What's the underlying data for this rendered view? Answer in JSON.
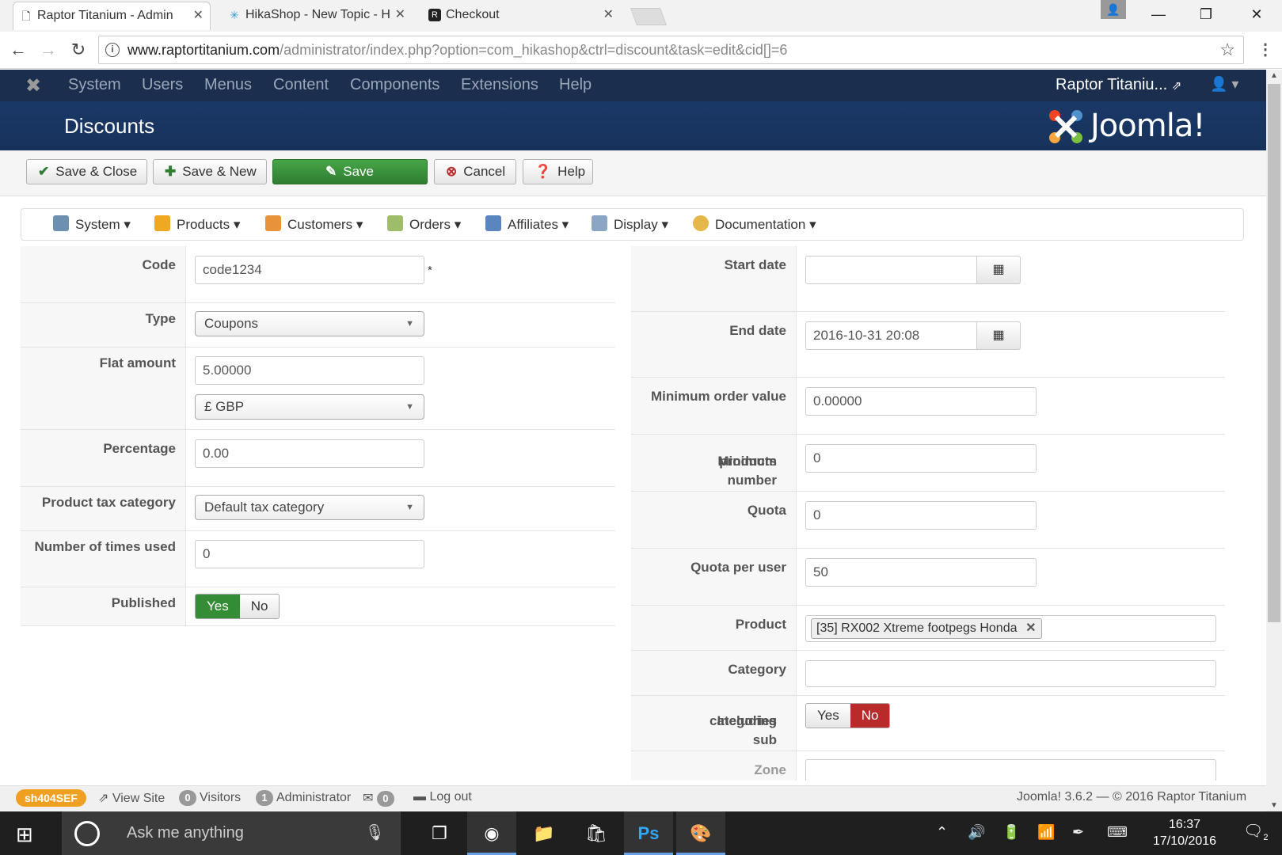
{
  "browser": {
    "tabs": [
      {
        "title": "Raptor Titanium - Admin",
        "icon": "page-icon",
        "active": true
      },
      {
        "title": "HikaShop - New Topic - H",
        "icon": "hikashop-icon",
        "active": false
      },
      {
        "title": "Checkout",
        "icon": "raptor-icon",
        "active": false
      }
    ],
    "url_host": "www.raptortitanium.com",
    "url_path": "/administrator/index.php?option=com_hikashop&ctrl=discount&task=edit&cid[]=6"
  },
  "admin_menu": {
    "items": [
      "System",
      "Users",
      "Menus",
      "Content",
      "Components",
      "Extensions",
      "Help"
    ],
    "site_name": "Raptor Titaniu..."
  },
  "page": {
    "title": "Discounts",
    "brand": "Joomla!"
  },
  "toolbar": {
    "save_close": "Save & Close",
    "save_new": "Save & New",
    "save": "Save",
    "cancel": "Cancel",
    "help": "Help"
  },
  "submenu": {
    "items": [
      "System",
      "Products",
      "Customers",
      "Orders",
      "Affiliates",
      "Display",
      "Documentation"
    ]
  },
  "left_form": {
    "code_label": "Code",
    "code_value": "code1234",
    "required_mark": "*",
    "type_label": "Type",
    "type_value": "Coupons",
    "flat_label": "Flat amount",
    "flat_value": "5.00000",
    "currency_value": "£ GBP",
    "percentage_label": "Percentage",
    "percentage_value": "0.00",
    "tax_label": "Product tax category",
    "tax_value": "Default tax category",
    "used_label": "Number of times used",
    "used_value": "0",
    "published_label": "Published",
    "yes": "Yes",
    "no": "No"
  },
  "right_form": {
    "start_label": "Start date",
    "start_value": "",
    "end_label": "End date",
    "end_value": "2016-10-31 20:08",
    "min_order_label": "Minimum order value",
    "min_order_value": "0.00000",
    "min_products_label_1": "Minimum number of",
    "min_products_label_2": "products",
    "min_products_value": "0",
    "quota_label": "Quota",
    "quota_value": "0",
    "quota_user_label": "Quota per user",
    "quota_user_value": "50",
    "product_label": "Product",
    "product_tag": "[35] RX002 Xtreme footpegs Honda",
    "category_label": "Category",
    "subcat_label_1": "Including sub",
    "subcat_label_2": "categories",
    "yes": "Yes",
    "no": "No",
    "zone_label": "Zone"
  },
  "statusbar": {
    "sef": "sh404SEF",
    "view_site": "View Site",
    "visitors_count": "0",
    "visitors": "Visitors",
    "admin_count": "1",
    "admin": "Administrator",
    "messages_count": "0",
    "logout": "Log out",
    "version": "Joomla! 3.6.2",
    "sep": "—",
    "copyright": "© 2016 Raptor Titanium"
  },
  "taskbar": {
    "search_placeholder": "Ask me anything",
    "time": "16:37",
    "date": "17/10/2016",
    "notifications": "2"
  },
  "colors": {
    "admin_bar": "#1b2e4e",
    "header": "#1a3867",
    "save_green": "#348d34",
    "no_red": "#b92a2a",
    "sef_orange": "#f0a020"
  }
}
